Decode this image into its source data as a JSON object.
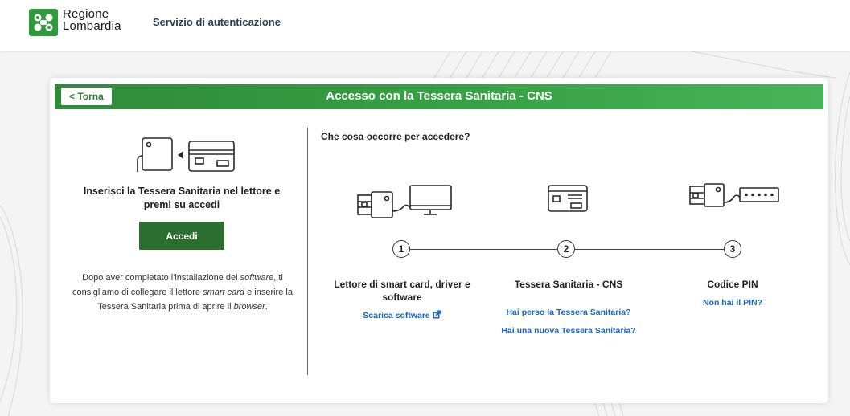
{
  "header": {
    "logo_line1": "Regione",
    "logo_line2": "Lombardia",
    "service_name": "Servizio di autenticazione"
  },
  "card": {
    "back_label": "< Torna",
    "title": "Accesso con la Tessera Sanitaria - CNS"
  },
  "left": {
    "insert_title": "Inserisci la Tessera Sanitaria nel lettore e premi su accedi",
    "accedi_label": "Accedi",
    "note_part1": "Dopo aver completato l'installazione del ",
    "note_software": "software",
    "note_part2": ", ti consigliamo di collegare il lettore ",
    "note_smartcard": "smart card",
    "note_part3": " e inserire la Tessera Sanitaria prima di aprire il ",
    "note_browser": "browser",
    "note_end": "."
  },
  "requirements": {
    "title": "Che cosa occorre per accedere?",
    "steps": [
      {
        "number": "1",
        "name": "Lettore di smart card, driver e software",
        "links": [
          "Scarica software"
        ]
      },
      {
        "number": "2",
        "name": "Tessera Sanitaria - CNS",
        "links": [
          "Hai perso la Tessera Sanitaria?",
          "Hai una nuova Tessera Sanitaria?"
        ]
      },
      {
        "number": "3",
        "name": "Codice PIN",
        "links": [
          "Non hai il PIN?"
        ]
      }
    ]
  },
  "colors": {
    "brand_green": "#38a446",
    "button_green": "#2c6e2f",
    "link_blue": "#1866c2"
  },
  "icons": [
    "logo-icon",
    "card-reader-icon",
    "computer-reader-icon",
    "health-card-icon",
    "pin-reader-icon",
    "external-link-icon"
  ]
}
